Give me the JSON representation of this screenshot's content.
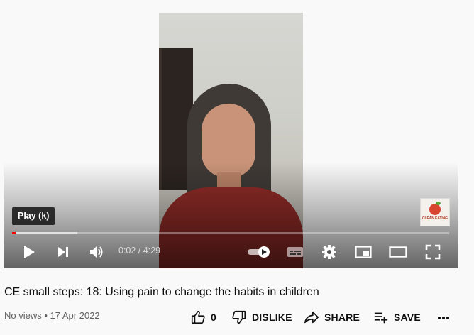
{
  "player": {
    "tooltip": "Play (k)",
    "time_current": "0:02",
    "time_separator": " / ",
    "time_total": "4:29",
    "progress_played_fraction": 0.004,
    "progress_loaded_fraction": 0.15,
    "channel_logo_text": "CLEAN EATING",
    "icons": [
      "play-icon",
      "next-icon",
      "volume-icon",
      "autoplay-toggle-icon",
      "subtitles-icon",
      "settings-icon",
      "miniplayer-icon",
      "theater-mode-icon",
      "fullscreen-icon"
    ]
  },
  "video": {
    "title": "CE small steps: 18: Using pain to change the habits in children",
    "views": "No views",
    "separator": " • ",
    "date": "17 Apr 2022"
  },
  "actions": {
    "like_count": "0",
    "dislike_label": "DISLIKE",
    "share_label": "SHARE",
    "save_label": "SAVE"
  },
  "colors": {
    "progress_red": "#ff0000",
    "background": "#f9f9f9"
  }
}
